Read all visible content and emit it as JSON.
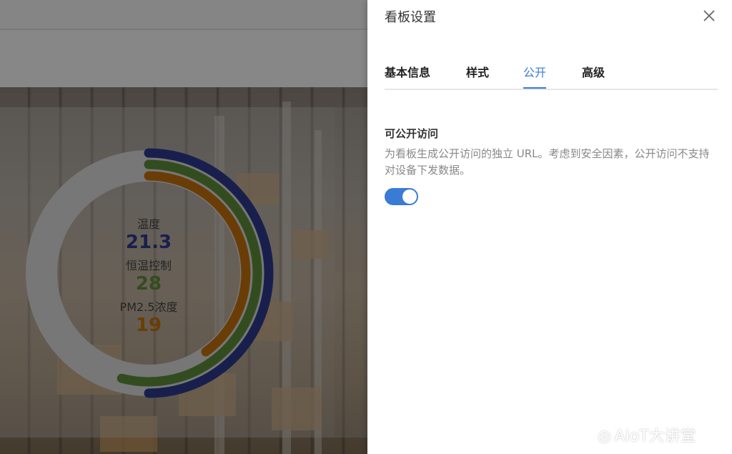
{
  "drawer": {
    "title": "看板设置",
    "tabs": [
      {
        "label": "基本信息",
        "active": false
      },
      {
        "label": "样式",
        "active": false
      },
      {
        "label": "公开",
        "active": true
      },
      {
        "label": "高级",
        "active": false
      }
    ],
    "section_title": "可公开访问",
    "section_desc": "为看板生成公开访问的独立 URL。考虑到安全因素，公开访问不支持对设备下发数据。",
    "public_access_enabled": true
  },
  "gauge": {
    "metrics": [
      {
        "label": "温度",
        "value": "21.3",
        "color": "#2e3a8c",
        "fraction": 0.5
      },
      {
        "label": "恒温控制",
        "value": "28",
        "color": "#5e8a3a",
        "fraction": 0.54
      },
      {
        "label": "PM2.5浓度",
        "value": "19",
        "color": "#c2700e",
        "fraction": 0.4
      }
    ]
  },
  "watermark": "AIoT大讲堂",
  "colors": {
    "accent": "#3a7bd5",
    "tab_text": "#222222",
    "desc_text": "#888888"
  },
  "icons": {
    "close": "close-icon",
    "watermark_logo": "weibo-icon"
  }
}
